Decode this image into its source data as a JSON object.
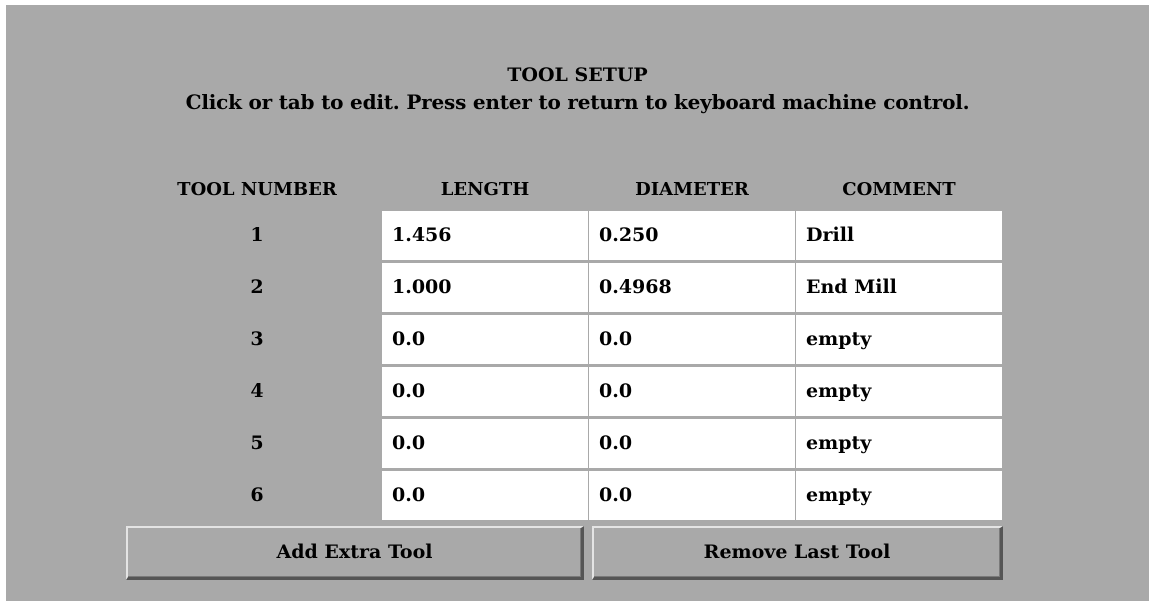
{
  "title": "TOOL SETUP",
  "instructions": "Click or tab to edit.   Press enter to return to keyboard machine control.",
  "columns": {
    "tool_number": "TOOL NUMBER",
    "length": "LENGTH",
    "diameter": "DIAMETER",
    "comment": "COMMENT"
  },
  "tools": [
    {
      "number": "1",
      "length": "1.456",
      "diameter": "0.250",
      "comment": "Drill"
    },
    {
      "number": "2",
      "length": "1.000",
      "diameter": "0.4968",
      "comment": "End Mill"
    },
    {
      "number": "3",
      "length": "0.0",
      "diameter": "0.0",
      "comment": "empty"
    },
    {
      "number": "4",
      "length": "0.0",
      "diameter": "0.0",
      "comment": "empty"
    },
    {
      "number": "5",
      "length": "0.0",
      "diameter": "0.0",
      "comment": "empty"
    },
    {
      "number": "6",
      "length": "0.0",
      "diameter": "0.0",
      "comment": "empty"
    }
  ],
  "buttons": {
    "add": "Add Extra Tool",
    "remove": "Remove Last Tool"
  },
  "colors": {
    "panel_background": "#a9a9a9",
    "field_background": "#ffffff",
    "text": "#000000"
  }
}
